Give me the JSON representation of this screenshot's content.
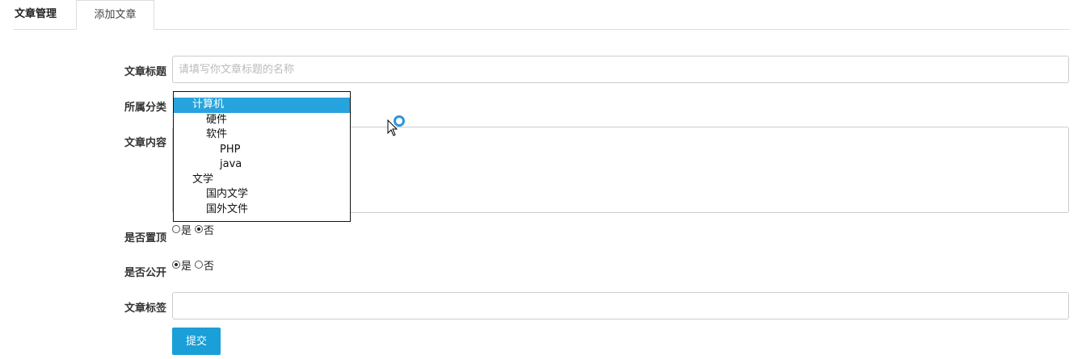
{
  "tabs": {
    "manage": "文章管理",
    "add": "添加文章"
  },
  "form": {
    "title_label": "文章标题",
    "title_placeholder": "请填写你文章标题的名称",
    "category_label": "所属分类",
    "content_label": "文章内容",
    "sticky_label": "是否置顶",
    "public_label": "是否公开",
    "tags_label": "文章标签",
    "yes": "是",
    "no": "否",
    "submit": "提交"
  },
  "category_options": [
    {
      "label": "计算机",
      "level": 0,
      "selected": true
    },
    {
      "label": "硬件",
      "level": 1,
      "selected": false
    },
    {
      "label": "软件",
      "level": 1,
      "selected": false
    },
    {
      "label": "PHP",
      "level": 2,
      "selected": false
    },
    {
      "label": "java",
      "level": 2,
      "selected": false
    },
    {
      "label": "文学",
      "level": 0,
      "selected": false
    },
    {
      "label": "国内文学",
      "level": 1,
      "selected": false
    },
    {
      "label": "国外文件",
      "level": 1,
      "selected": false
    }
  ],
  "sticky": "no",
  "public": "yes",
  "colors": {
    "accent": "#1a9fd8",
    "selected_option": "#27a3dd",
    "border": "#cccccc"
  },
  "icons": {
    "cursor": "arrow-cursor-icon",
    "indicator": "loading-ring-icon"
  }
}
